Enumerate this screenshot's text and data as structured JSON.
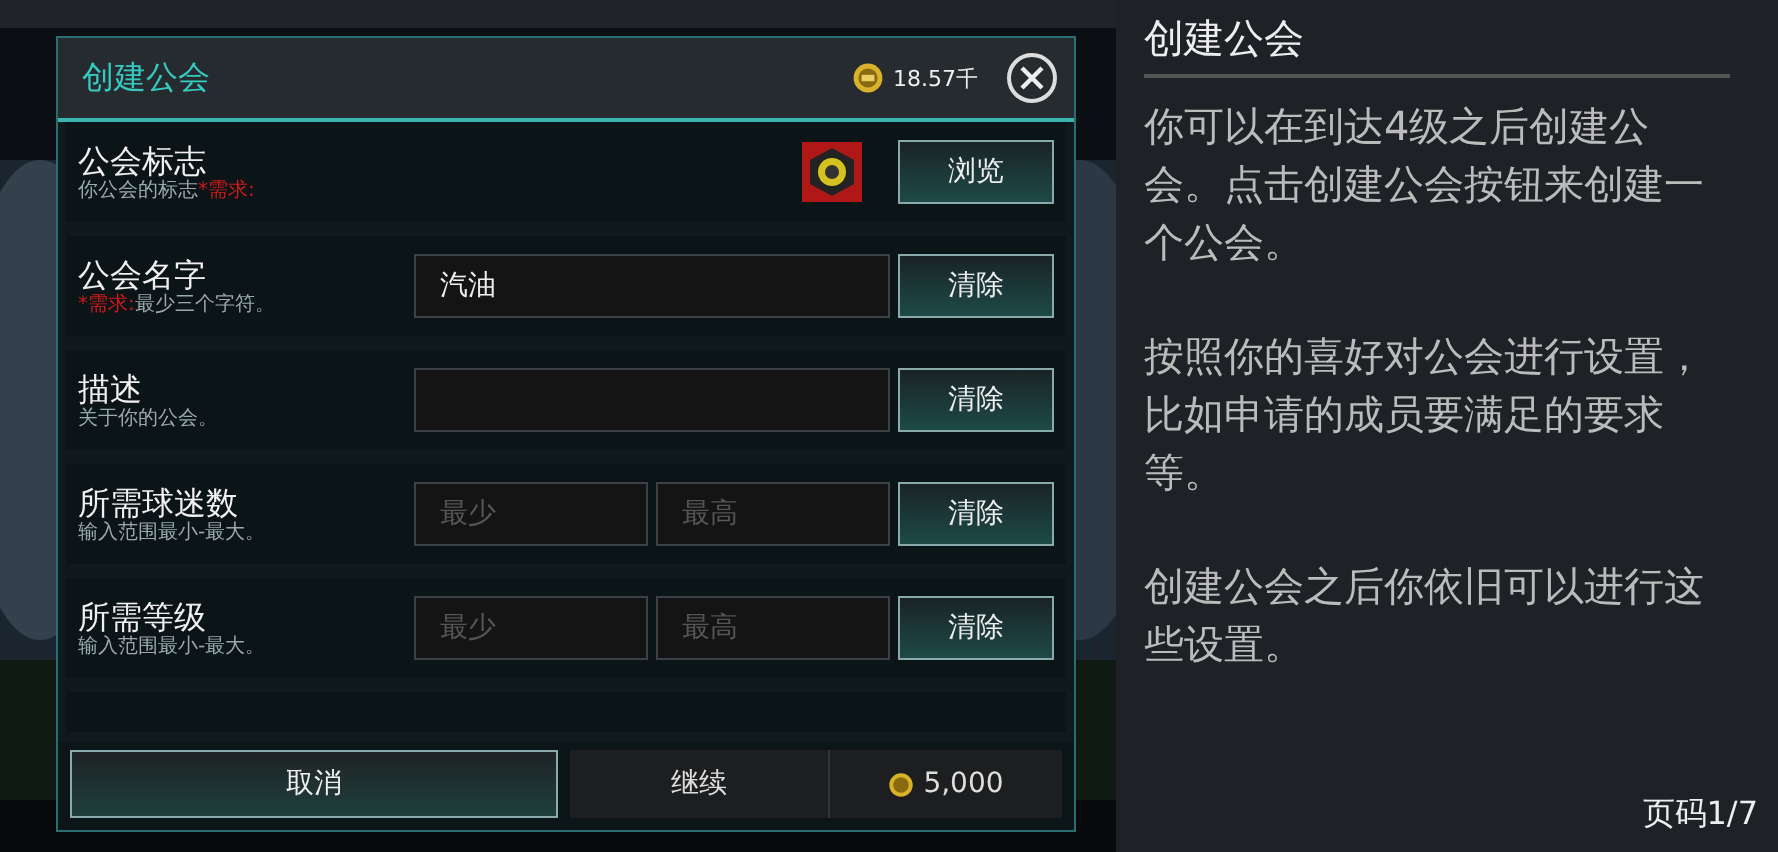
{
  "dialog": {
    "title": "创建公会",
    "currency": "18.57千",
    "rows": [
      {
        "kind": "emblem",
        "label": "公会标志",
        "hint": [
          {
            "kind": "normal",
            "text": "你公会的标志"
          },
          {
            "kind": "required",
            "text": "*需求:"
          }
        ],
        "button": "浏览"
      },
      {
        "kind": "text",
        "label": "公会名字",
        "hint": [
          {
            "kind": "required",
            "text": "*需求:"
          },
          {
            "kind": "normal",
            "text": "最少三个字符。"
          }
        ],
        "fields": [
          {
            "value": "汽油"
          }
        ],
        "button": "清除"
      },
      {
        "kind": "text",
        "label": "描述",
        "hint": [
          {
            "kind": "normal",
            "text": "关于你的公会。"
          }
        ],
        "button": "清除"
      },
      {
        "kind": "range",
        "label": "所需球迷数",
        "hint": [
          {
            "kind": "normal",
            "text": "输入范围最小-最大。"
          }
        ],
        "fields": [
          {
            "placeholder": "最少"
          },
          {
            "placeholder": "最高"
          }
        ],
        "button": "清除"
      },
      {
        "kind": "range",
        "label": "所需等级",
        "hint": [
          {
            "kind": "normal",
            "text": "输入范围最小-最大。"
          }
        ],
        "fields": [
          {
            "placeholder": "最少"
          },
          {
            "placeholder": "最高"
          }
        ],
        "button": "清除"
      }
    ],
    "cancel": "取消",
    "continue": "继续",
    "cost": "5,000"
  },
  "help": {
    "title": "创建公会",
    "paragraphs": [
      "你可以在到达4级之后创建公会。点击创建公会按钮来创建一个公会。",
      "按照你的喜好对公会进行设置，比如申请的成员要满足的要求等。",
      "创建公会之后你依旧可以进行这些设置。"
    ],
    "page": "页码1/7"
  }
}
